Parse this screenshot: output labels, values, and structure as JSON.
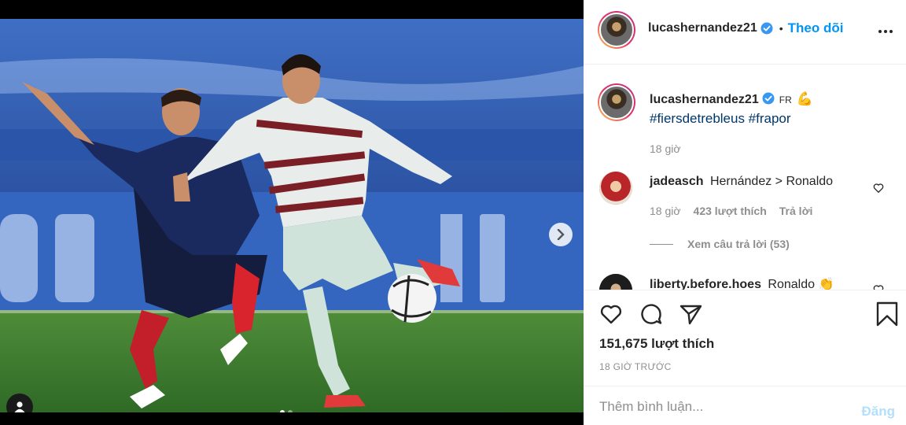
{
  "post": {
    "username": "lucashernandez21",
    "follow_label": "Theo dõi",
    "header_separator": "•"
  },
  "caption": {
    "username": "lucashernandez21",
    "language": "FR",
    "emoji": "💪",
    "hashtags": "#fiersdetrebleus #frapor",
    "time": "18 giờ"
  },
  "comments": [
    {
      "username": "jadeasch",
      "text": "Hernández > Ronaldo",
      "time": "18 giờ",
      "likes": "423 lượt thích",
      "reply_label": "Trả lời",
      "view_replies": "Xem câu trả lời (53)"
    },
    {
      "username": "liberty.before.hoes",
      "text": "Ronaldo 👏"
    }
  ],
  "actions": {
    "like_count": "151,675 lượt thích",
    "time_ago": "18 GIỜ TRƯỚC"
  },
  "add_comment": {
    "placeholder": "Thêm bình luận...",
    "post_label": "Đăng"
  },
  "icons": {
    "verified": "verified-badge-icon",
    "like": "heart-icon",
    "comment": "comment-bubble-icon",
    "share": "paper-plane-icon",
    "save": "bookmark-icon",
    "more": "more-options-icon",
    "next": "chevron-right-icon",
    "tag": "user-tag-icon"
  },
  "media": {
    "carousel_count": 2,
    "carousel_index": 1
  },
  "colors": {
    "accent": "#0095f6",
    "hashtag": "#00376b",
    "muted": "#8e8e8e",
    "post_disabled": "#b2dffc"
  }
}
